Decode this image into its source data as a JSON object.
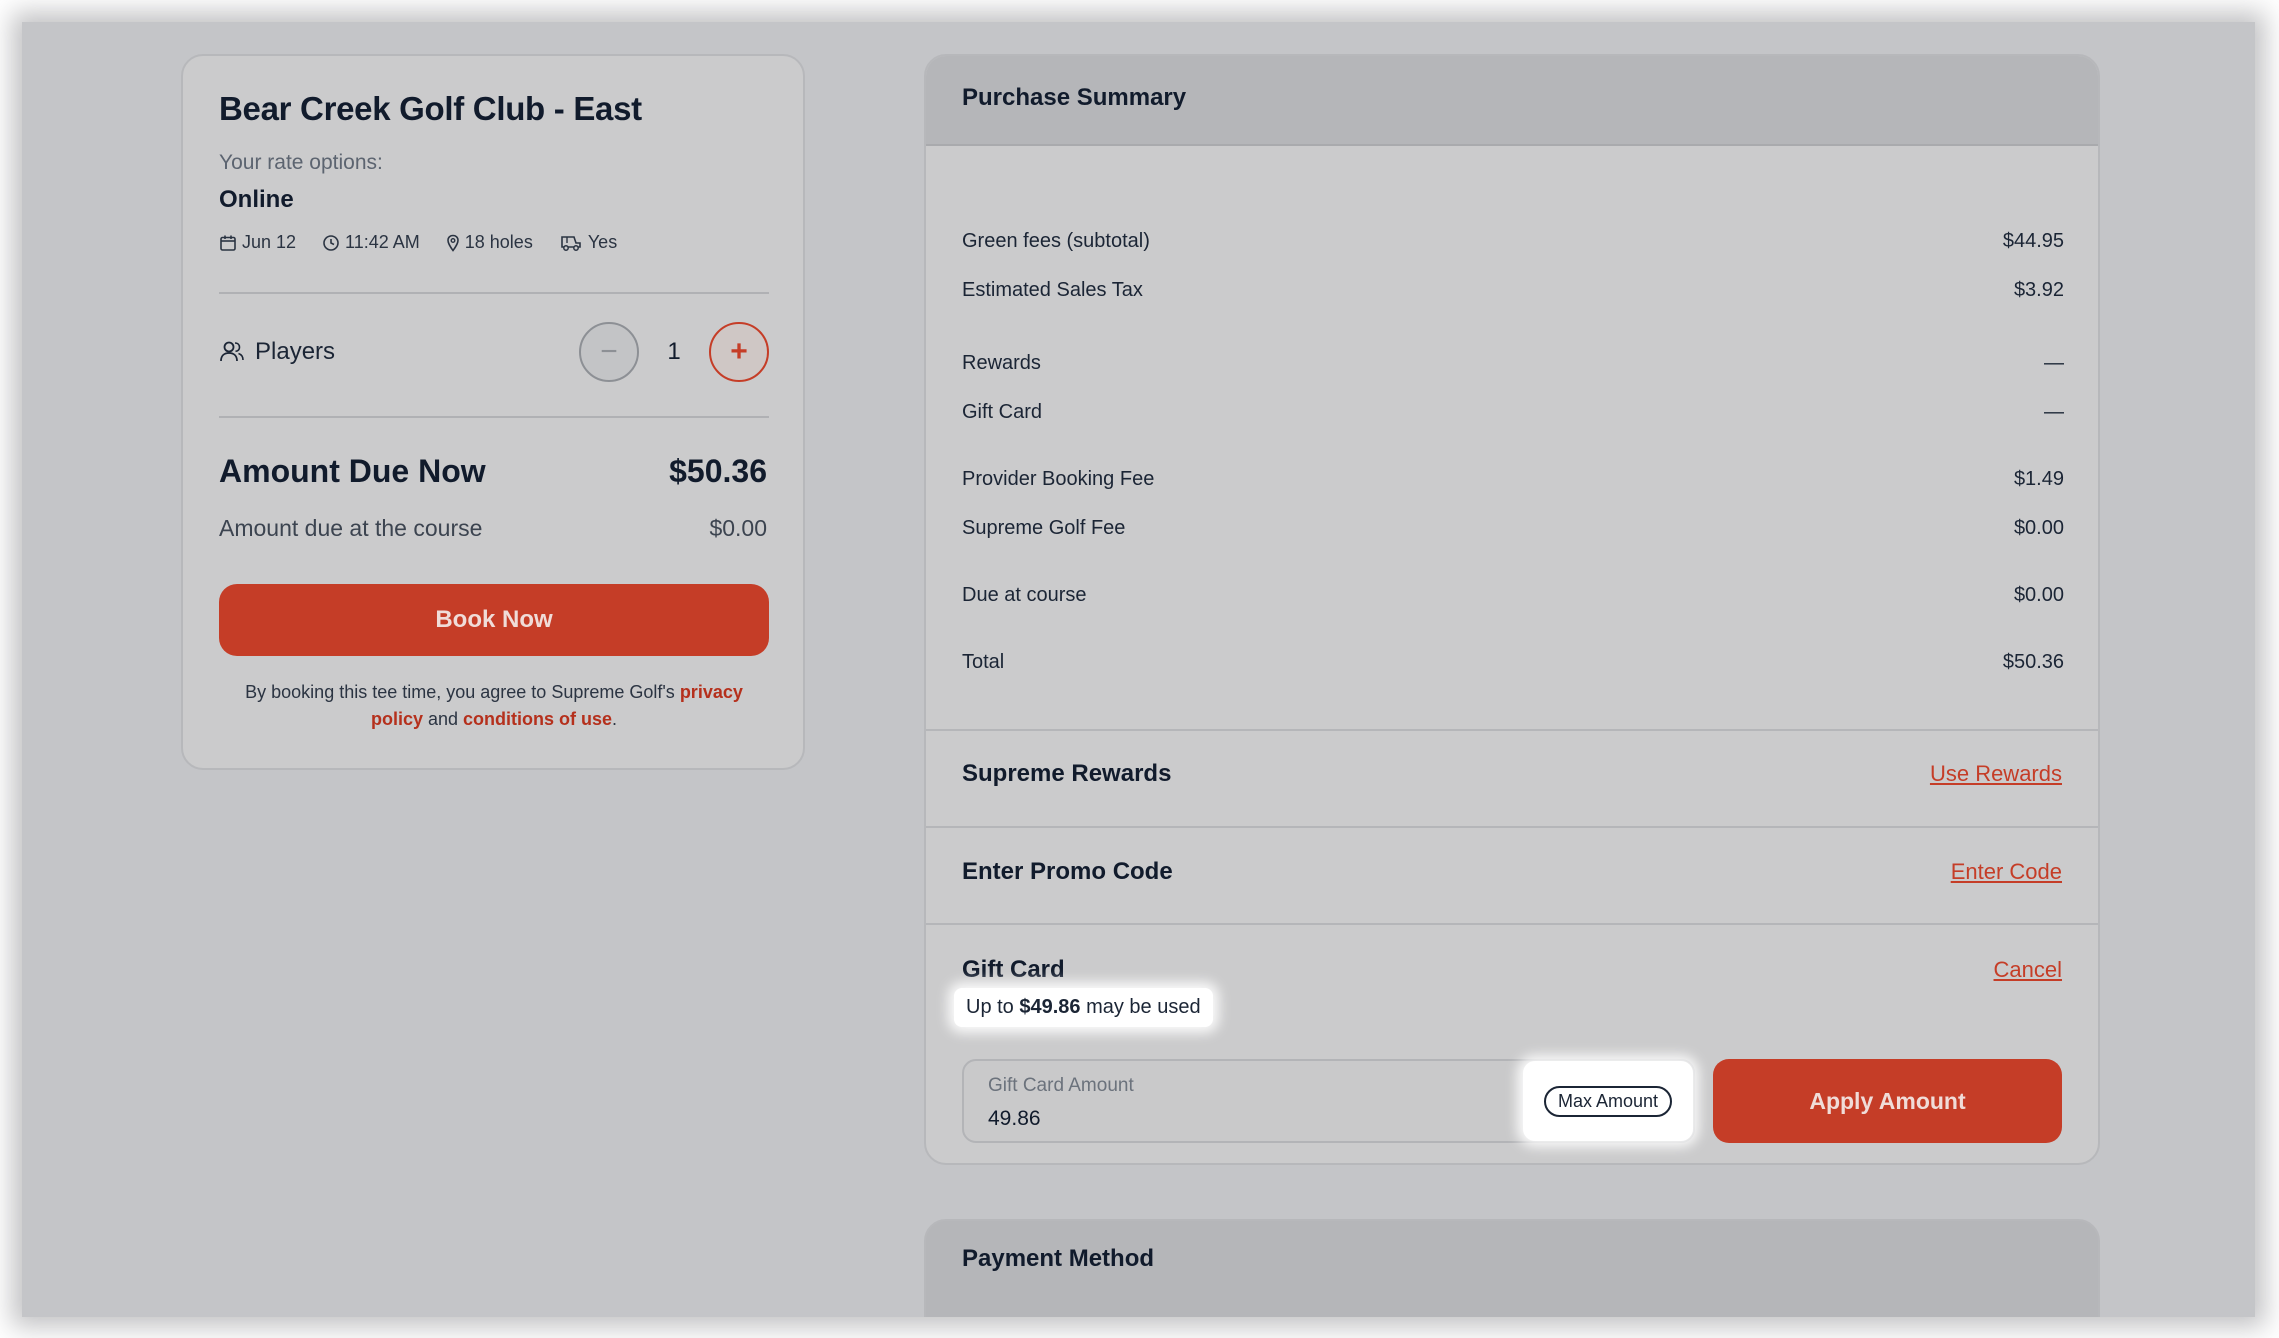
{
  "booking": {
    "course_name": "Bear Creek Golf Club - East",
    "rate_label": "Your rate options:",
    "rate_value": "Online",
    "date": "Jun 12",
    "time": "11:42 AM",
    "holes": "18 holes",
    "cart": "Yes",
    "players_label": "Players",
    "players_count": "1",
    "minus_symbol": "−",
    "plus_symbol": "+",
    "amount_due_now_label": "Amount Due Now",
    "amount_due_now_value": "$50.36",
    "amount_due_course_label": "Amount due at the course",
    "amount_due_course_value": "$0.00",
    "book_button": "Book Now",
    "terms_prefix": "By booking this tee time, you agree to Supreme Golf's ",
    "terms_privacy": "privacy policy",
    "terms_and": " and ",
    "terms_conditions": "conditions of use",
    "terms_suffix": "."
  },
  "summary": {
    "title": "Purchase Summary",
    "lines": [
      {
        "label": "Green fees (subtotal)",
        "value": "$44.95"
      },
      {
        "label": "Estimated Sales Tax",
        "value": "$3.92"
      },
      {
        "label": "Rewards",
        "value": "—"
      },
      {
        "label": "Gift Card",
        "value": "—"
      },
      {
        "label": "Provider Booking Fee",
        "value": "$1.49"
      },
      {
        "label": "Supreme Golf Fee",
        "value": "$0.00"
      },
      {
        "label": "Due at course",
        "value": "$0.00"
      },
      {
        "label": "Total",
        "value": "$50.36"
      }
    ],
    "rewards_title": "Supreme Rewards",
    "rewards_link": "Use Rewards",
    "promo_title": "Enter Promo Code",
    "promo_link": "Enter Code",
    "giftcard_title": "Gift Card",
    "giftcard_cancel": "Cancel",
    "giftcard_note_prefix": "Up to ",
    "giftcard_note_amount": "$49.86",
    "giftcard_note_suffix": " may be used",
    "giftcard_input_label": "Gift Card Amount",
    "giftcard_input_value": "49.86",
    "max_amount_button": "Max Amount",
    "apply_button": "Apply Amount"
  },
  "payment": {
    "title": "Payment Method"
  },
  "colors": {
    "accent": "#c53d27",
    "overlay": "#c4c5c8",
    "text": "#111b2c"
  }
}
